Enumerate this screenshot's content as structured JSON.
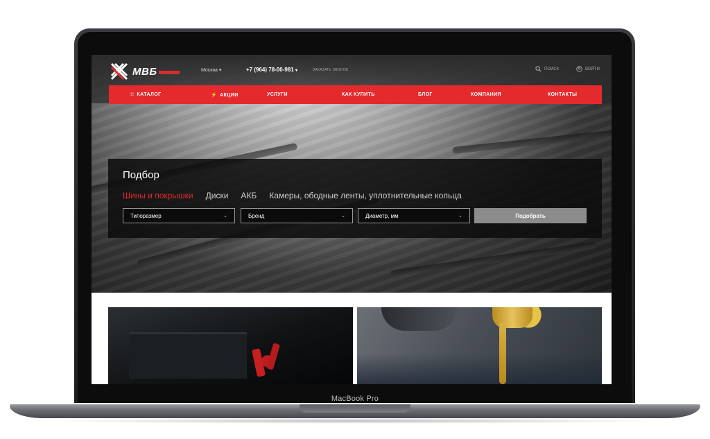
{
  "device": {
    "label": "MacBook Pro"
  },
  "header": {
    "brand": "МВБ",
    "city": "Москва",
    "phone": "+7 (964) 78-00-981",
    "callback": "ЗАКАЗАТЬ ЗВОНОК",
    "search_label": "ПОИСК",
    "login_label": "ВОЙТИ"
  },
  "nav": {
    "items": [
      {
        "label": "КАТАЛОГ",
        "icon": "grid-icon"
      },
      {
        "label": "АКЦИИ",
        "icon": "lightning-icon"
      },
      {
        "label": "УСЛУГИ"
      },
      {
        "label": "КАК КУПИТЬ"
      },
      {
        "label": "БЛОГ"
      },
      {
        "label": "КОМПАНИЯ"
      },
      {
        "label": "КОНТАКТЫ"
      }
    ]
  },
  "selector": {
    "title": "Подбор",
    "tabs": [
      {
        "label": "Шины и покрышки",
        "active": true
      },
      {
        "label": "Диски"
      },
      {
        "label": "АКБ"
      },
      {
        "label": "Камеры, ободные ленты, уплотнительные кольца"
      }
    ],
    "fields": [
      {
        "label": "Типоразмер"
      },
      {
        "label": "Бренд"
      },
      {
        "label": "Диаметр, мм"
      }
    ],
    "submit": "Подобрать"
  },
  "colors": {
    "accent": "#e52a2e",
    "panel": "#0c0c0c"
  }
}
